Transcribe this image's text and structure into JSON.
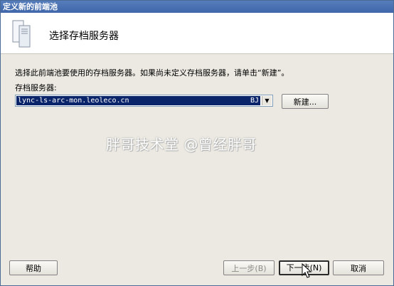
{
  "window": {
    "title": "定义新的前端池"
  },
  "header": {
    "title": "选择存档服务器",
    "icon": "server-icon"
  },
  "main": {
    "description": "选择此前端池要使用的存档服务器。如果尚未定义存档服务器，请单击“新建”。",
    "archive_label": "存档服务器:",
    "archive_server": {
      "value": "lync-ls-arc-mon.leoleco.cn",
      "site": "BJ"
    },
    "new_button": "新建..."
  },
  "watermark": "胖哥技术堂 @曾经胖哥",
  "footer": {
    "help_button": "帮助",
    "back_button": "上一步(B)",
    "next_button": "下一步(N)",
    "cancel_button": "取消"
  }
}
